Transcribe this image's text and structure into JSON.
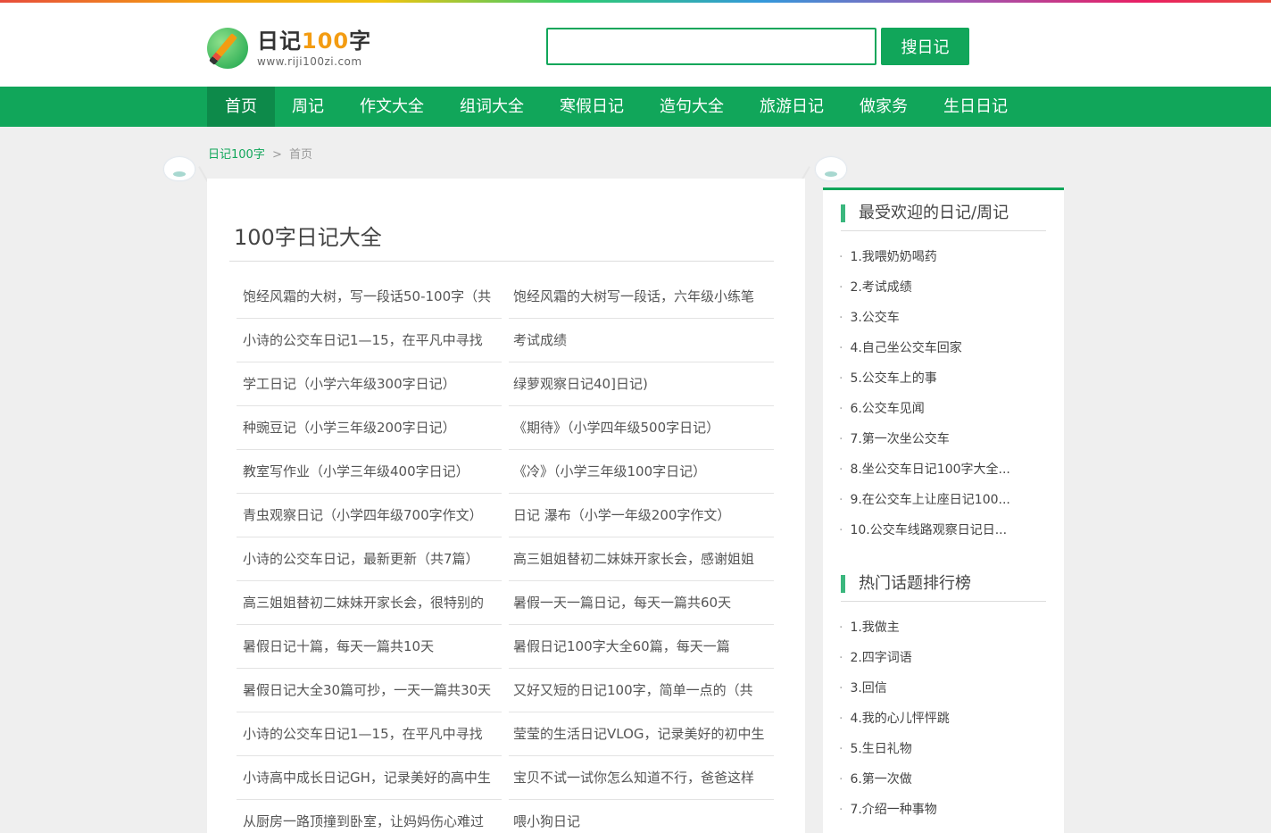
{
  "logo": {
    "title_prefix": "日记",
    "title_num": "100",
    "title_suffix": "字",
    "url": "www.riji100zi.com"
  },
  "search": {
    "placeholder": "",
    "button_label": "搜日记"
  },
  "nav": [
    "首页",
    "周记",
    "作文大全",
    "组词大全",
    "寒假日记",
    "造句大全",
    "旅游日记",
    "做家务",
    "生日日记"
  ],
  "breadcrumb": {
    "home": "日记100字",
    "sep": ">",
    "current": "首页"
  },
  "main": {
    "title": "100字日记大全",
    "rows": [
      [
        "饱经风霜的大树，写一段话50-100字（共",
        "饱经风霜的大树写一段话，六年级小练笔"
      ],
      [
        "小诗的公交车日记1—15，在平凡中寻找",
        "考试成绩"
      ],
      [
        "学工日记（小学六年级300字日记）",
        "绿萝观察日记40]日记)"
      ],
      [
        "种豌豆记（小学三年级200字日记）",
        "《期待》（小学四年级500字日记）"
      ],
      [
        "教室写作业（小学三年级400字日记）",
        "《冷》（小学三年级100字日记）"
      ],
      [
        "青虫观察日记（小学四年级700字作文）",
        "日记 瀑布（小学一年级200字作文）"
      ],
      [
        "小诗的公交车日记，最新更新（共7篇）",
        "高三姐姐替初二妹妹开家长会，感谢姐姐"
      ],
      [
        "高三姐姐替初二妹妹开家长会，很特别的",
        "暑假一天一篇日记，每天一篇共60天"
      ],
      [
        "暑假日记十篇，每天一篇共10天",
        "暑假日记100字大全60篇，每天一篇"
      ],
      [
        "暑假日记大全30篇可抄，一天一篇共30天",
        "又好又短的日记100字，简单一点的（共"
      ],
      [
        "小诗的公交车日记1—15，在平凡中寻找",
        "莹莹的生活日记VLOG，记录美好的初中生"
      ],
      [
        "小诗高中成长日记GH，记录美好的高中生",
        "宝贝不试一试你怎么知道不行，爸爸这样"
      ],
      [
        "从厨房一路顶撞到卧室，让妈妈伤心难过",
        "喂小狗日记"
      ]
    ]
  },
  "sidebar": {
    "popular_title": "最受欢迎的日记/周记",
    "popular": [
      "1.我喂奶奶喝药",
      "2.考试成绩",
      "3.公交车",
      "4.自己坐公交车回家",
      "5.公交车上的事",
      "6.公交车见闻",
      "7.第一次坐公交车",
      "8.坐公交车日记100字大全...",
      "9.在公交车上让座日记100...",
      "10.公交车线路观察日记日..."
    ],
    "hot_title": "热门话题排行榜",
    "hot": [
      "1.我做主",
      "2.四字词语",
      "3.回信",
      "4.我的心儿怦怦跳",
      "5.生日礼物",
      "6.第一次做",
      "7.介绍一种事物"
    ]
  },
  "colors": {
    "brand": "#11a65a",
    "brand_dark": "#0d8a4a",
    "accent": "#f39c12"
  }
}
